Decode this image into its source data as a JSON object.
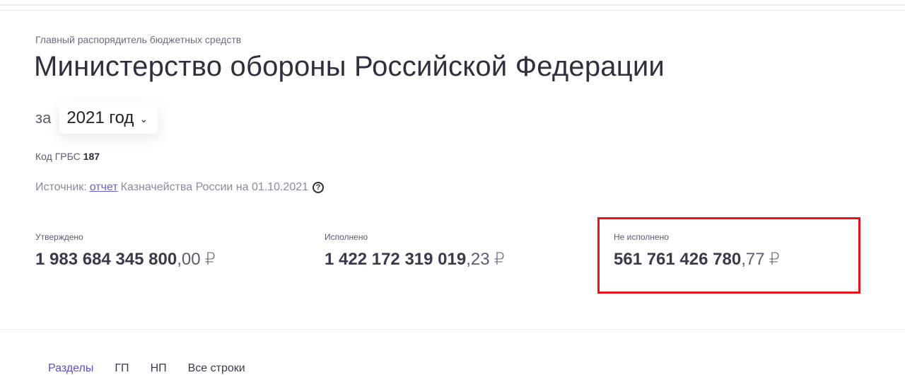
{
  "header": {
    "subtitle": "Главный распорядитель бюджетных средств",
    "title": "Министерство обороны Российской Федерации"
  },
  "year": {
    "prefix": "за",
    "selected": "2021 год"
  },
  "code": {
    "label": "Код ГРБС",
    "value": "187"
  },
  "source": {
    "prefix": "Источник:",
    "link": "отчет",
    "suffix": "Казначейства России на 01.10.2021"
  },
  "metrics": [
    {
      "label": "Утверждено",
      "integer": "1 983 684 345 800",
      "fraction": ",00",
      "currency": "₽"
    },
    {
      "label": "Исполнено",
      "integer": "1 422 172 319 019",
      "fraction": ",23",
      "currency": "₽"
    },
    {
      "label": "Не исполнено",
      "integer": "561 761 426 780",
      "fraction": ",77",
      "currency": "₽"
    }
  ],
  "colors": {
    "highlight": "#e4141a",
    "accent": "#5a4fc0"
  },
  "tabs": [
    {
      "label": "Разделы"
    },
    {
      "label": "ГП"
    },
    {
      "label": "НП"
    },
    {
      "label": "Все строки"
    }
  ]
}
